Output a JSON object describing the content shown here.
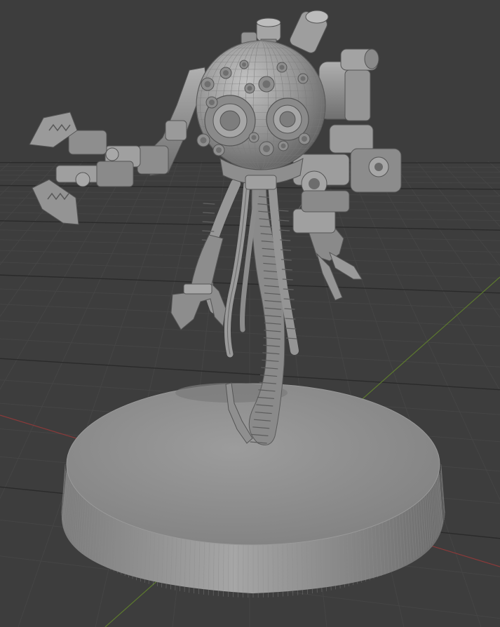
{
  "viewport": {
    "background_color": "#3d3d3d",
    "grid_color": "#454545",
    "grid_major_color": "#2a2a2a",
    "x_axis_color": "#8a3a3a",
    "y_axis_color": "#5d7a2e",
    "model_color": "#8f8f8f",
    "model_shadow_color": "#6a6a6a",
    "model_highlight_color": "#b8b8b8"
  },
  "scene_object": {
    "icon": "robot-sculpt-icon"
  }
}
